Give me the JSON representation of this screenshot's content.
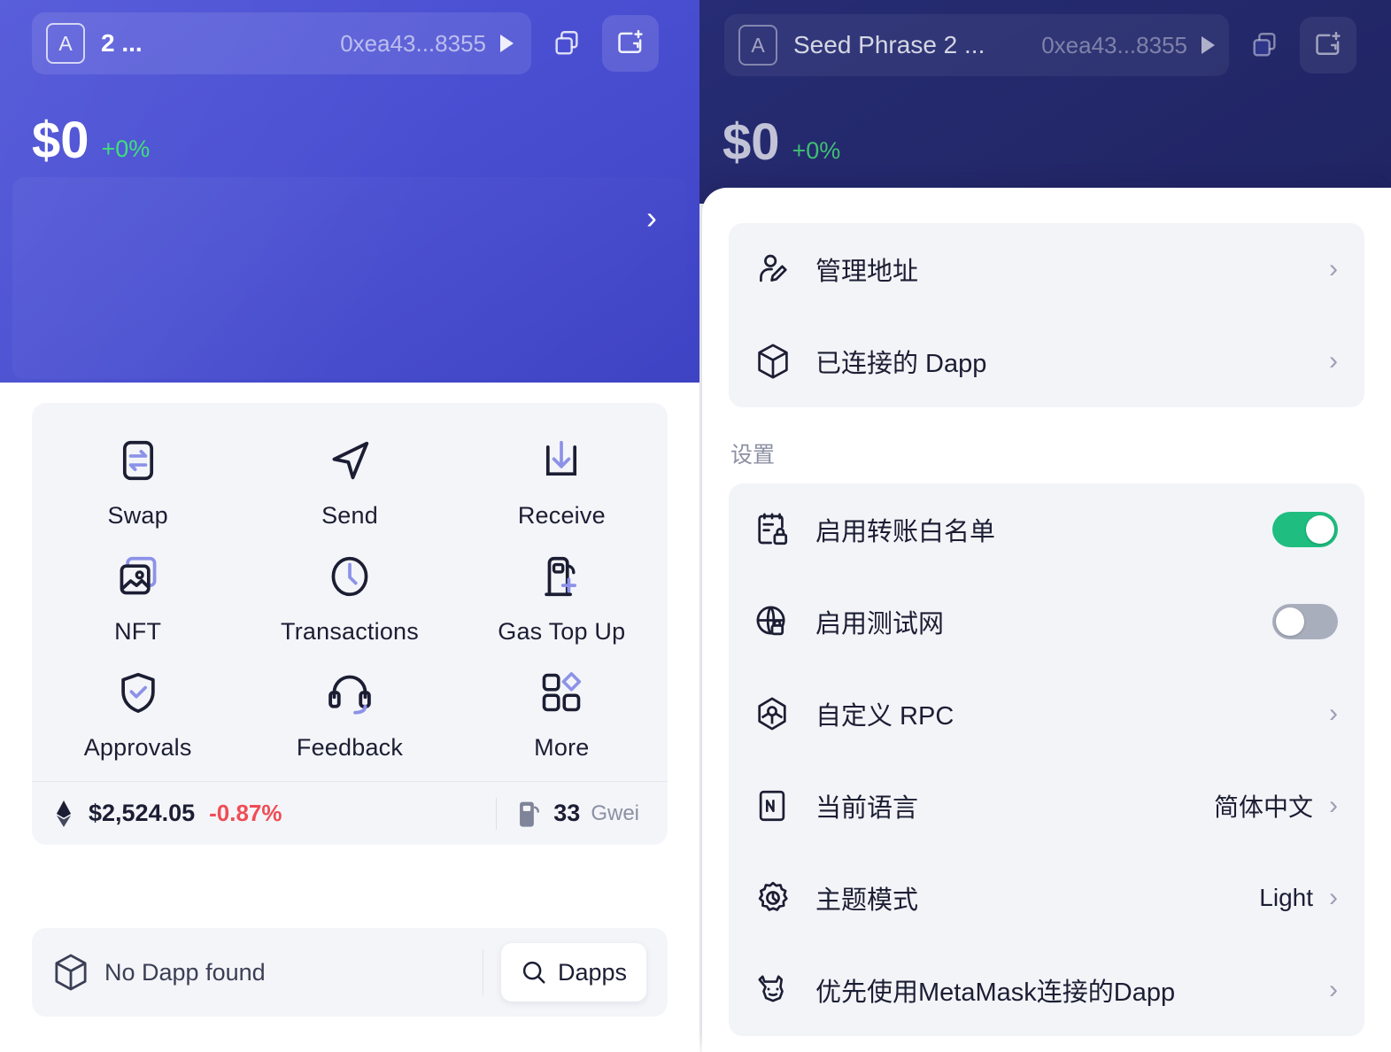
{
  "left_panel": {
    "header": {
      "avatar_letter": "A",
      "account_name": "2 ...",
      "account_address": "0xea43...8355",
      "caret_icon": "play-caret-icon",
      "copy_icon": "copy-icon",
      "add_wallet_icon": "add-wallet-icon"
    },
    "balance": {
      "amount": "$0",
      "change": "+0%"
    },
    "promo_card": {
      "chevron": "›"
    },
    "actions": [
      {
        "label": "Swap",
        "icon": "swap-icon"
      },
      {
        "label": "Send",
        "icon": "send-icon"
      },
      {
        "label": "Receive",
        "icon": "receive-icon"
      },
      {
        "label": "NFT",
        "icon": "nft-image-icon"
      },
      {
        "label": "Transactions",
        "icon": "clock-icon"
      },
      {
        "label": "Gas Top Up",
        "icon": "gas-pump-plus-icon"
      },
      {
        "label": "Approvals",
        "icon": "shield-check-icon"
      },
      {
        "label": "Feedback",
        "icon": "headset-icon"
      },
      {
        "label": "More",
        "icon": "grid-more-icon"
      }
    ],
    "price_bar": {
      "eth_icon": "ethereum-icon",
      "price": "$2,524.05",
      "change": "-0.87%",
      "gas_icon": "gas-pump-icon",
      "gas_value": "33",
      "gas_unit": "Gwei"
    },
    "dapp_bar": {
      "cube_icon": "cube-icon",
      "empty_text": "No Dapp found",
      "search_icon": "search-icon",
      "button_label": "Dapps"
    }
  },
  "right_panel": {
    "header": {
      "avatar_letter": "A",
      "account_name": "Seed Phrase 2 ...",
      "account_address": "0xea43...8355",
      "caret_icon": "play-caret-icon",
      "copy_icon": "copy-icon",
      "add_wallet_icon": "add-wallet-icon"
    },
    "balance": {
      "amount": "$0",
      "change": "+0%"
    },
    "sheet": {
      "top_group": [
        {
          "label": "管理地址",
          "icon": "user-edit-icon",
          "type": "chevron",
          "chevron": "›"
        },
        {
          "label": "已连接的 Dapp",
          "icon": "cube-icon",
          "type": "chevron",
          "chevron": "›"
        }
      ],
      "section_label": "设置",
      "settings_group": [
        {
          "label": "启用转账白名单",
          "icon": "whitelist-lock-icon",
          "type": "toggle",
          "toggle_on": true
        },
        {
          "label": "启用测试网",
          "icon": "globe-lock-icon",
          "type": "toggle",
          "toggle_on": false
        },
        {
          "label": "自定义 RPC",
          "icon": "rpc-node-icon",
          "type": "chevron",
          "chevron": "›"
        },
        {
          "label": "当前语言",
          "icon": "language-en-icon",
          "type": "value",
          "value": "简体中文",
          "chevron": "›"
        },
        {
          "label": "主题模式",
          "icon": "theme-sun-icon",
          "type": "value",
          "value": "Light",
          "chevron": "›"
        },
        {
          "label": "优先使用MetaMask连接的Dapp",
          "icon": "metamask-fox-icon",
          "type": "chevron",
          "chevron": "›"
        }
      ]
    }
  },
  "colors": {
    "brand_blue": "#4a4fd2",
    "brand_blue_dim": "#2f3589",
    "accent_green": "#3ee07a",
    "toggle_on": "#1fbd7f",
    "toggle_off": "#a9aebd",
    "negative_red": "#ef4d56",
    "icon_dark": "#1b1e33",
    "icon_light_purple": "#8c92e8",
    "card_bg": "#f3f4f8"
  }
}
